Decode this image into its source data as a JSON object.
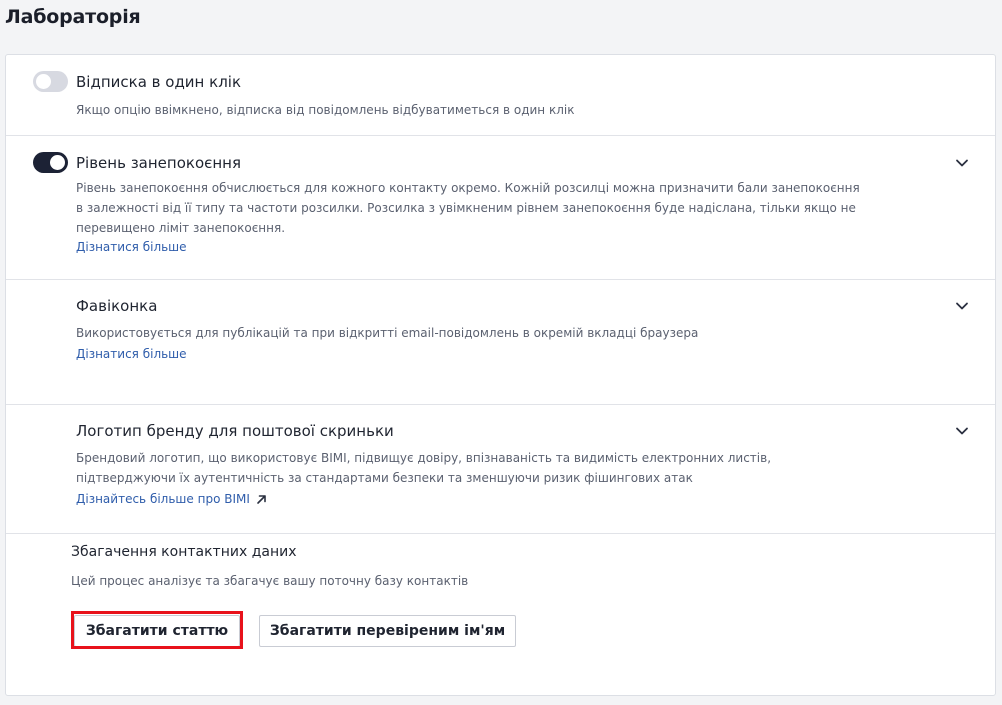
{
  "page": {
    "title": "Лабораторія"
  },
  "sections": {
    "one_click_unsubscribe": {
      "toggle_state": "off",
      "title": "Відписка в один клік",
      "description": "Якщо опцію ввімкнено, відписка від повідомлень відбуватиметься в один клік"
    },
    "anxiety_level": {
      "toggle_state": "on",
      "title": "Рівень занепокоєння",
      "description_lines": [
        "Рівень занепокоєння обчислюється для кожного контакту окремо. Кожній розсилці можна призначити бали занепокоєння",
        "в залежності від її типу та частоти розсилки. Розсилка з увімкненим рівнем занепокоєння буде надіслана, тільки якщо не",
        "перевищено ліміт занепокоєння."
      ],
      "link": "Дізнатися більше",
      "chevron_icon": "chevron-down-icon"
    },
    "favicon": {
      "title": "Фавіконка",
      "description": "Використовується для публікацій та при відкритті email-повідомлень в окремій вкладці браузера",
      "link": "Дізнатися більше",
      "chevron_icon": "chevron-down-icon"
    },
    "brand_logo": {
      "title": "Логотип бренду для поштової скриньки",
      "description_lines": [
        "Брендовий логотип, що використовує BIMI, підвищує довіру, впізнаваність та видимість електронних листів,",
        "підтверджуючи їх аутентичність за стандартами безпеки та зменшуючи ризик фішингових атак"
      ],
      "link": "Дізнайтесь більше про BIMI",
      "link_icon": "arrow-up-right-icon",
      "chevron_icon": "chevron-down-icon"
    },
    "contact_enrichment": {
      "title": "Збагачення контактних даних",
      "description": "Цей процес аналізує та збагачує вашу поточну базу контактів",
      "buttons": {
        "enrich_article": "Збагатити статтю",
        "enrich_verified_name": "Збагатити перевіреним ім'ям"
      }
    }
  },
  "colors": {
    "link": "#2f5dab",
    "toggle_on": "#1c2235",
    "toggle_off": "#d7d9e1",
    "highlight": "#e8121b"
  }
}
